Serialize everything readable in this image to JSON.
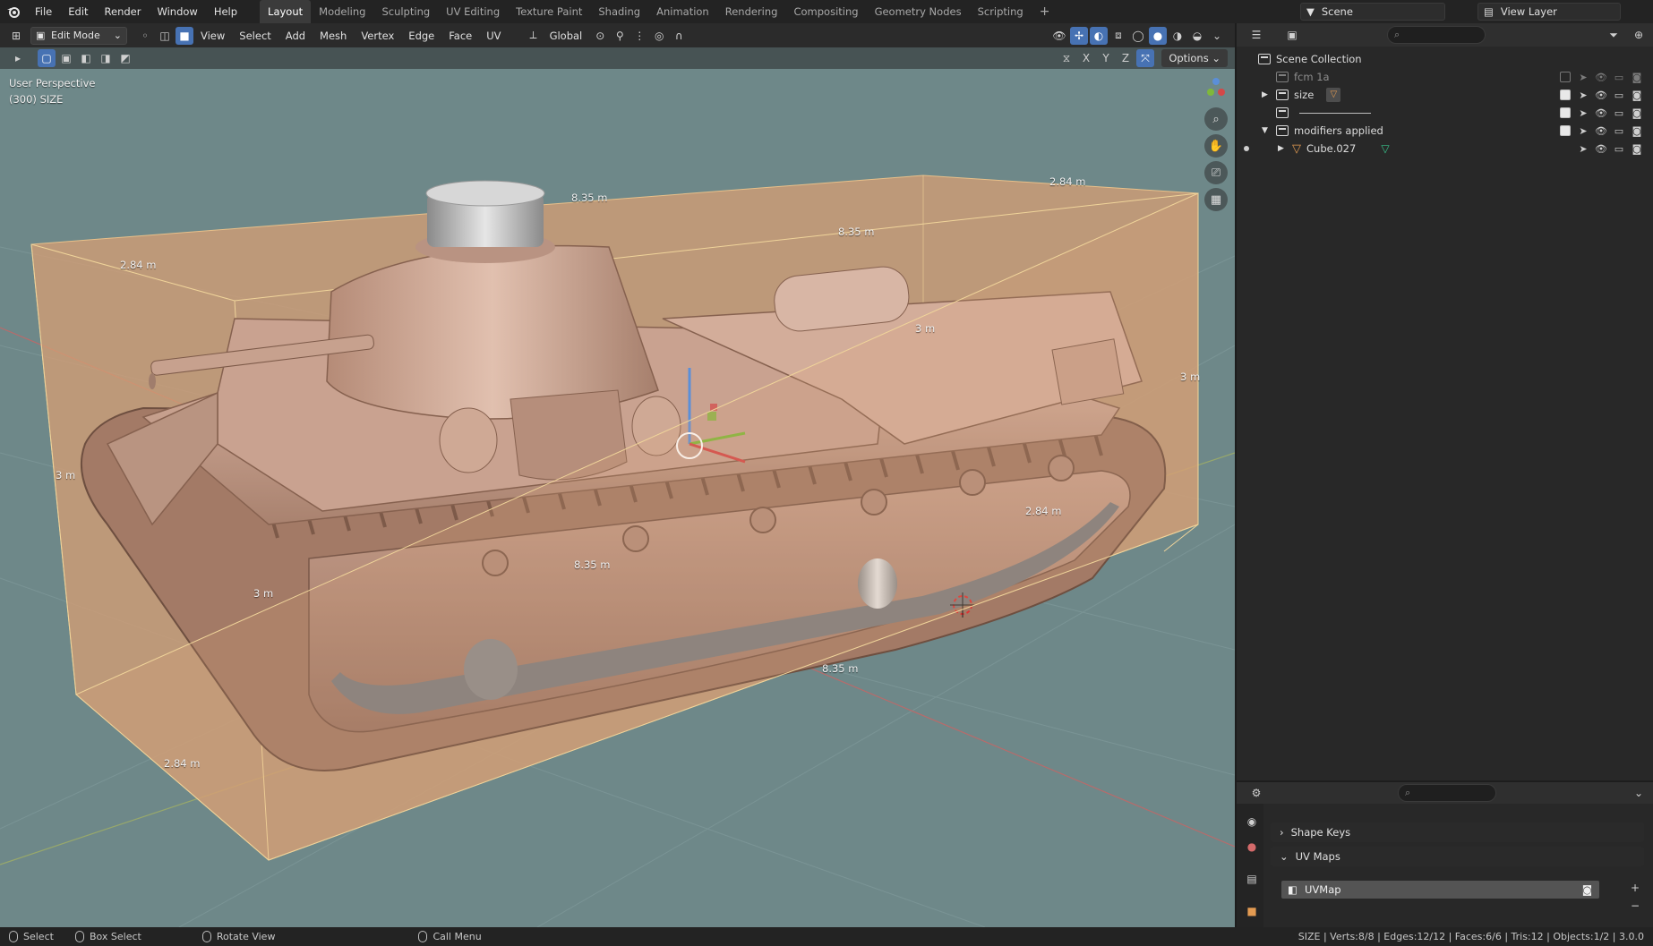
{
  "topbar": {
    "menus": [
      "File",
      "Edit",
      "Render",
      "Window",
      "Help"
    ],
    "workspaces": [
      "Layout",
      "Modeling",
      "Sculpting",
      "UV Editing",
      "Texture Paint",
      "Shading",
      "Animation",
      "Rendering",
      "Compositing",
      "Geometry Nodes",
      "Scripting"
    ],
    "active_workspace": "Layout",
    "scene_name": "Scene",
    "view_layer_name": "View Layer"
  },
  "viewport": {
    "mode": "Edit Mode",
    "header_menus": [
      "View",
      "Select",
      "Add",
      "Mesh",
      "Vertex",
      "Edge",
      "Face",
      "UV"
    ],
    "orientation": "Global",
    "axis_labels": [
      "X",
      "Y",
      "Z"
    ],
    "options_label": "Options",
    "perspective_label": "User Perspective",
    "object_label": "(300) SIZE",
    "dimensions": [
      "8.35 m",
      "8.35 m",
      "8.35 m",
      "8.35 m",
      "2.84 m",
      "2.84 m",
      "2.84 m",
      "2.84 m",
      "3 m",
      "3 m",
      "3 m",
      "3 m"
    ]
  },
  "outliner": {
    "root": "Scene Collection",
    "items": [
      {
        "label": "fcm 1a",
        "checked": false,
        "dim": true
      },
      {
        "label": "size",
        "checked": true,
        "dim": false
      },
      {
        "label": "",
        "checked": true,
        "dim": false
      },
      {
        "label": "modifiers applied",
        "checked": true,
        "dim": false
      },
      {
        "label": "Cube.027",
        "checked": null,
        "dim": false
      }
    ]
  },
  "properties": {
    "shape_keys_label": "Shape Keys",
    "uv_maps_label": "UV Maps",
    "uv_map_name": "UVMap"
  },
  "statusbar": {
    "select_label": "Select",
    "box_select_label": "Box Select",
    "rotate_label": "Rotate View",
    "call_menu_label": "Call Menu",
    "stats": "SIZE | Verts:8/8 | Edges:12/12 | Faces:6/6 | Tris:12 | Objects:1/2 | 3.0.0"
  },
  "colors": {
    "accent": "#4772b3",
    "viewport_bg": "#6e8889",
    "mesh": "#c9a290",
    "box_face": "#d8a27a"
  }
}
